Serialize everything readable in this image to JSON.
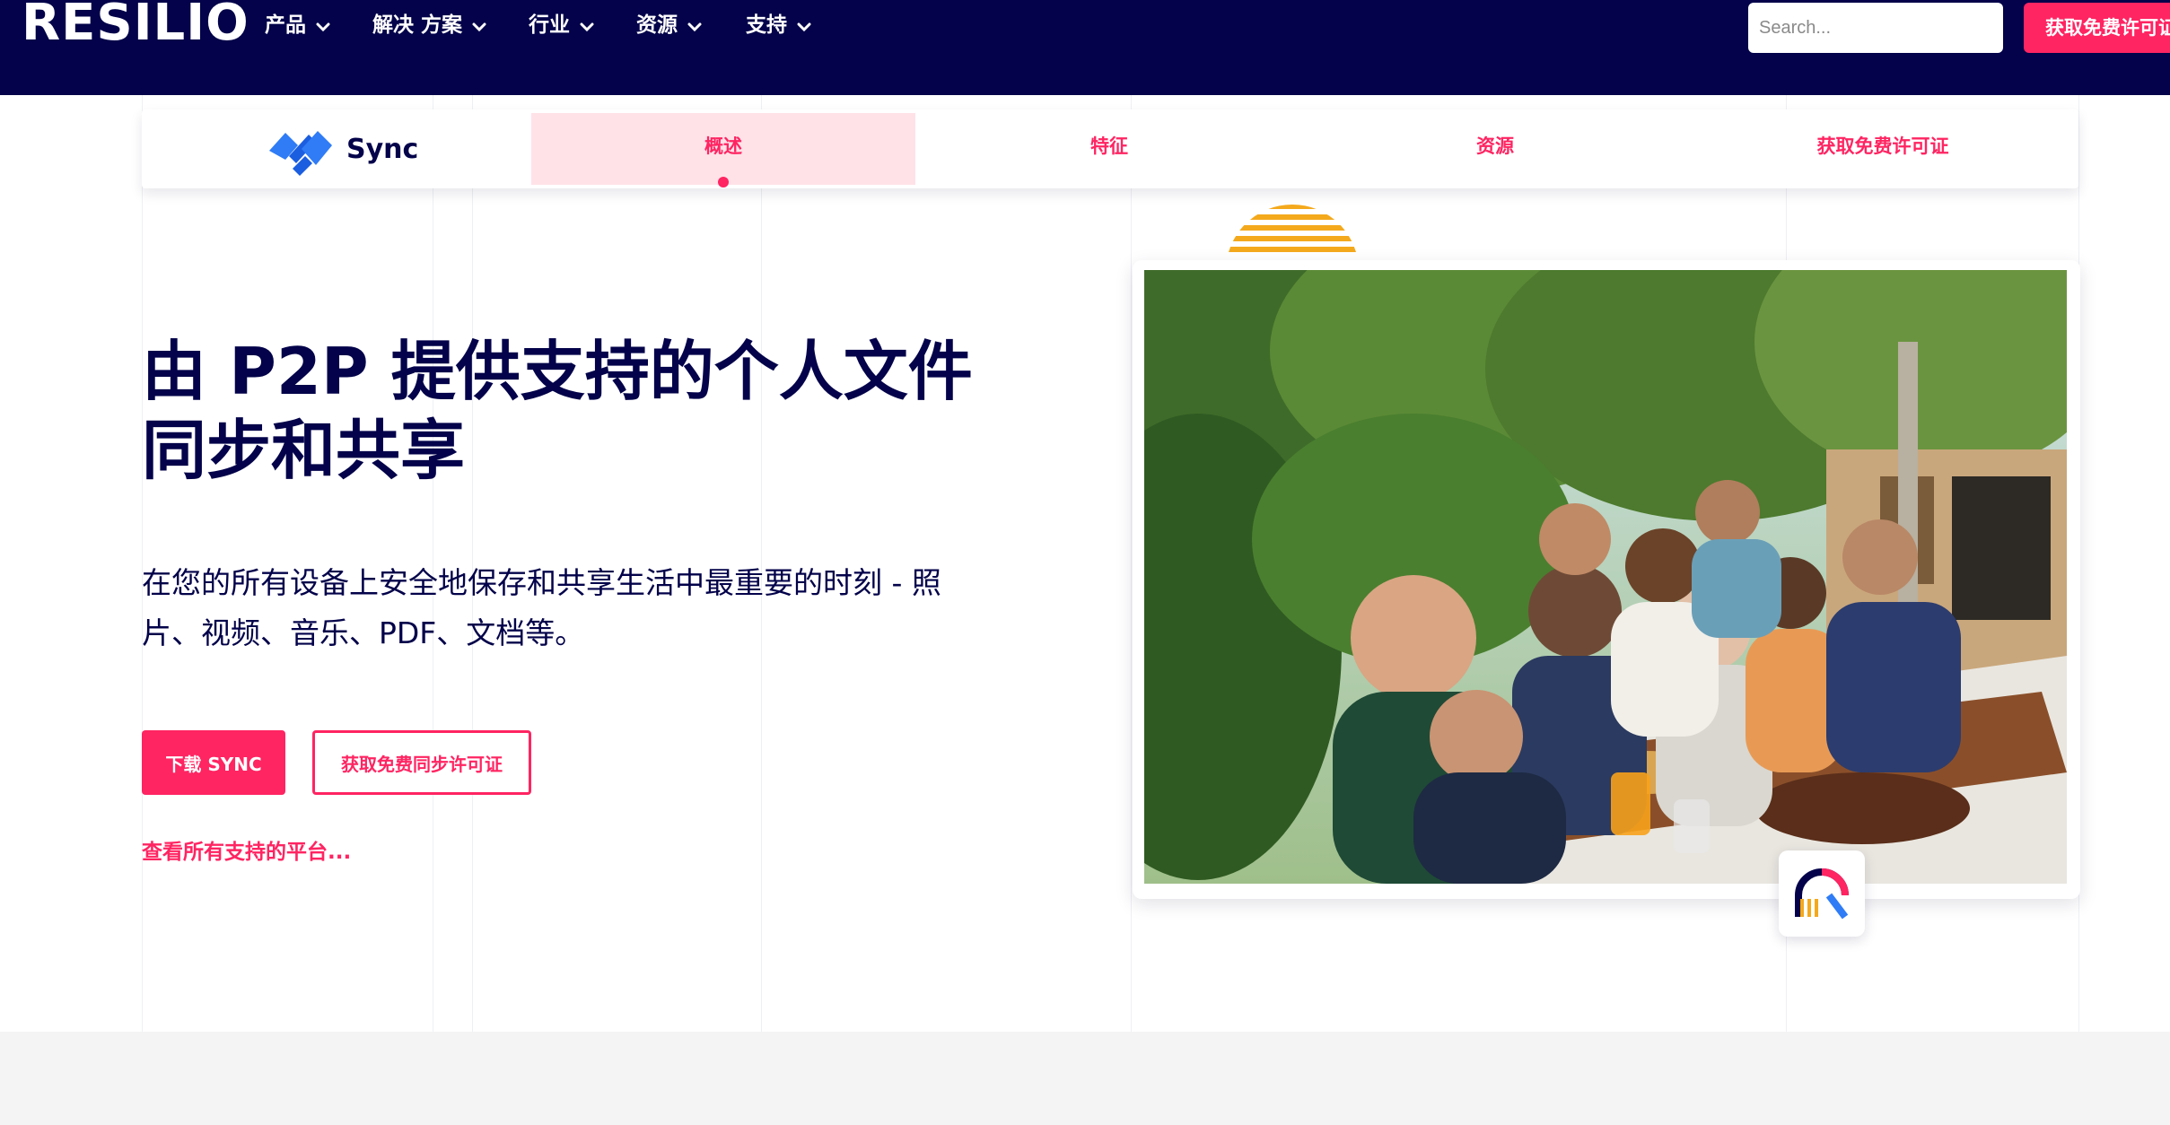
{
  "topbar": {
    "logo": "RESILIO",
    "nav": [
      {
        "label": "产品"
      },
      {
        "label": "解决 方案"
      },
      {
        "label": "行业"
      },
      {
        "label": "资源"
      },
      {
        "label": "支持"
      }
    ],
    "search_placeholder": "Search...",
    "cta_label": "获取免费许可证"
  },
  "subnav": {
    "brand": "Sync",
    "tabs": [
      {
        "label": "概述",
        "active": true
      },
      {
        "label": "特征"
      },
      {
        "label": "资源"
      },
      {
        "label": "获取免费许可证"
      }
    ]
  },
  "hero": {
    "title_line1": "由 P2P 提供支持的个人文件",
    "title_line2": "同步和共享",
    "desc_line1": "在您的所有设备上安全地保存和共享生活中最重要的时刻 - 照",
    "desc_line2": "片、视频、音乐、PDF、文档等。",
    "primary_button": "下载 SYNC",
    "secondary_button": "获取免费同步许可证",
    "platform_link": "查看所有支持的平台..."
  },
  "colors": {
    "navy": "#03024a",
    "accent": "#ff2462",
    "sync_blue": "#2f7cf6",
    "sun_orange": "#f4a91c"
  }
}
